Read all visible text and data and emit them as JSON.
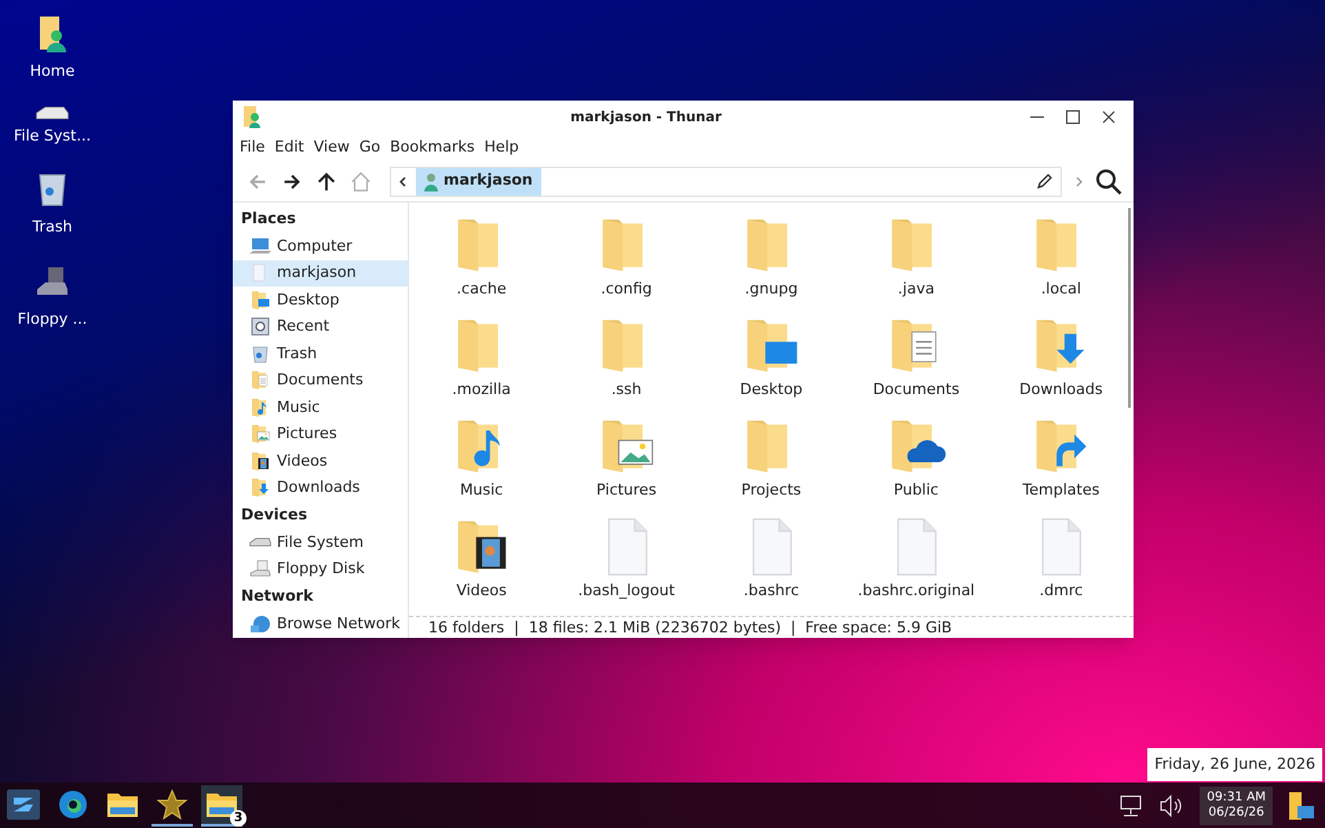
{
  "desktop_icons": [
    {
      "label": "Home",
      "kind": "home"
    },
    {
      "label": "File Syst...",
      "kind": "drive"
    },
    {
      "label": "Trash",
      "kind": "trash"
    },
    {
      "label": "Floppy ...",
      "kind": "floppy"
    }
  ],
  "window": {
    "title": "markjason - Thunar",
    "menu": [
      "File",
      "Edit",
      "View",
      "Go",
      "Bookmarks",
      "Help"
    ],
    "toolbar": [
      {
        "kind": "back",
        "disabled": true
      },
      {
        "kind": "forward",
        "disabled": false
      },
      {
        "kind": "up",
        "disabled": false
      },
      {
        "kind": "home",
        "disabled": true
      }
    ],
    "path": [
      {
        "label": "markjason",
        "selected": true
      }
    ],
    "sidebar": [
      {
        "heading": "Places",
        "items": [
          {
            "label": "Computer",
            "kind": "computer",
            "selected": false
          },
          {
            "label": "markjason",
            "kind": "home",
            "selected": true
          },
          {
            "label": "Desktop",
            "kind": "desktop",
            "selected": false
          },
          {
            "label": "Recent",
            "kind": "recent",
            "selected": false
          },
          {
            "label": "Trash",
            "kind": "trash",
            "selected": false
          },
          {
            "label": "Documents",
            "kind": "documents",
            "selected": false
          },
          {
            "label": "Music",
            "kind": "music",
            "selected": false
          },
          {
            "label": "Pictures",
            "kind": "pictures",
            "selected": false
          },
          {
            "label": "Videos",
            "kind": "videos",
            "selected": false
          },
          {
            "label": "Downloads",
            "kind": "downloads",
            "selected": false
          }
        ]
      },
      {
        "heading": "Devices",
        "items": [
          {
            "label": "File System",
            "kind": "drive",
            "selected": false
          },
          {
            "label": "Floppy Disk",
            "kind": "floppy",
            "selected": false
          }
        ]
      },
      {
        "heading": "Network",
        "items": [
          {
            "label": "Browse Network",
            "kind": "network",
            "selected": false
          }
        ]
      }
    ],
    "files": [
      {
        "label": ".cache",
        "kind": "folder"
      },
      {
        "label": ".config",
        "kind": "folder"
      },
      {
        "label": ".gnupg",
        "kind": "folder"
      },
      {
        "label": ".java",
        "kind": "folder"
      },
      {
        "label": ".local",
        "kind": "folder"
      },
      {
        "label": ".mozilla",
        "kind": "folder"
      },
      {
        "label": ".ssh",
        "kind": "folder"
      },
      {
        "label": "Desktop",
        "kind": "desktop"
      },
      {
        "label": "Documents",
        "kind": "documents"
      },
      {
        "label": "Downloads",
        "kind": "downloads"
      },
      {
        "label": "Music",
        "kind": "music"
      },
      {
        "label": "Pictures",
        "kind": "pictures"
      },
      {
        "label": "Projects",
        "kind": "folder"
      },
      {
        "label": "Public",
        "kind": "public"
      },
      {
        "label": "Templates",
        "kind": "templates"
      },
      {
        "label": "Videos",
        "kind": "videos"
      },
      {
        "label": ".bash_logout",
        "kind": "file"
      },
      {
        "label": ".bashrc",
        "kind": "file"
      },
      {
        "label": ".bashrc.original",
        "kind": "file"
      },
      {
        "label": ".dmrc",
        "kind": "file"
      }
    ],
    "status_bar": "16 folders  |  18 files: 2.1 MiB (2236702 bytes)  |  Free space: 5.9 GiB"
  },
  "tooltip": "Friday, 26 June, 2026",
  "taskbar": {
    "apps": [
      {
        "kind": "start",
        "running": false,
        "selected": false
      },
      {
        "kind": "browser",
        "running": false,
        "selected": false
      },
      {
        "kind": "files",
        "running": false,
        "selected": false
      },
      {
        "kind": "star",
        "running": true,
        "selected": false
      },
      {
        "kind": "files",
        "running": true,
        "selected": true,
        "badge": "3"
      }
    ],
    "clock": {
      "time": "09:31 AM",
      "date": "06/26/26"
    }
  }
}
